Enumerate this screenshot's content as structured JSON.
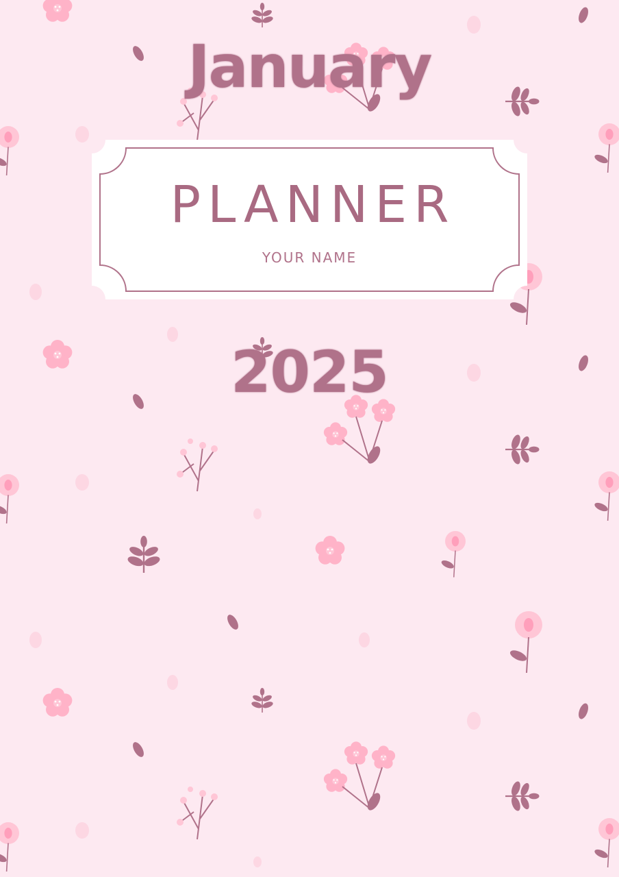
{
  "cover": {
    "month": "January",
    "title": "PLANNER",
    "name_placeholder": "YOUR NAME",
    "year": "2025"
  },
  "colors": {
    "background": "#fde9f1",
    "accent": "#b0728a",
    "flower_pink": "#ffb3c8",
    "card_fill": "#ffffff"
  },
  "decorations": {
    "icons": [
      "flower-icon",
      "leaf-icon",
      "sprig-icon",
      "tulip-icon",
      "dot-icon"
    ]
  }
}
